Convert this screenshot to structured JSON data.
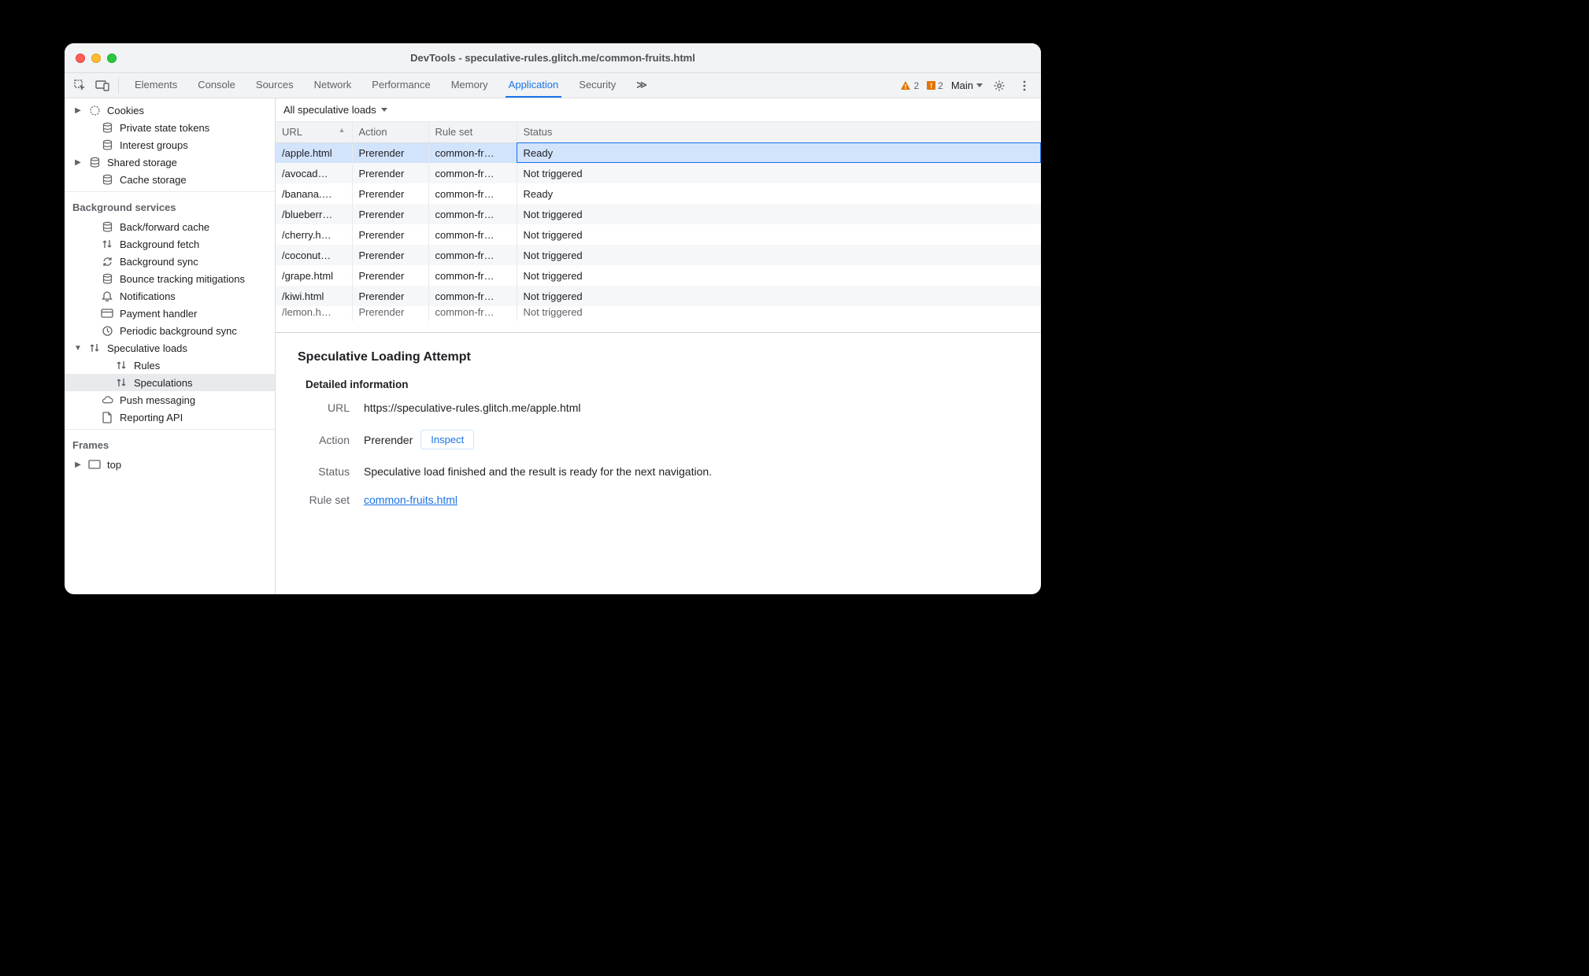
{
  "window_title": "DevTools - speculative-rules.glitch.me/common-fruits.html",
  "toolbar": {
    "tabs": [
      "Elements",
      "Console",
      "Sources",
      "Network",
      "Performance",
      "Memory",
      "Application",
      "Security"
    ],
    "active_tab": "Application",
    "overflow_glyph": "≫",
    "warnings_count": "2",
    "issues_count": "2",
    "target_label": "Main",
    "issue_sq_glyph": "!"
  },
  "sidebar": {
    "group_app": [
      {
        "label": "Cookies",
        "icon": "cookies",
        "arrow": "▶",
        "indent": 0
      },
      {
        "label": "Private state tokens",
        "icon": "db",
        "arrow": "",
        "indent": 1
      },
      {
        "label": "Interest groups",
        "icon": "db",
        "arrow": "",
        "indent": 1
      },
      {
        "label": "Shared storage",
        "icon": "db",
        "arrow": "▶",
        "indent": 0
      },
      {
        "label": "Cache storage",
        "icon": "db",
        "arrow": "",
        "indent": 1
      }
    ],
    "bg_header": "Background services",
    "group_bg": [
      {
        "label": "Back/forward cache",
        "icon": "db",
        "arrow": "",
        "indent": 1
      },
      {
        "label": "Background fetch",
        "icon": "updown",
        "arrow": "",
        "indent": 1
      },
      {
        "label": "Background sync",
        "icon": "sync",
        "arrow": "",
        "indent": 1
      },
      {
        "label": "Bounce tracking mitigations",
        "icon": "db",
        "arrow": "",
        "indent": 1
      },
      {
        "label": "Notifications",
        "icon": "bell",
        "arrow": "",
        "indent": 1
      },
      {
        "label": "Payment handler",
        "icon": "card",
        "arrow": "",
        "indent": 1
      },
      {
        "label": "Periodic background sync",
        "icon": "clock",
        "arrow": "",
        "indent": 1
      },
      {
        "label": "Speculative loads",
        "icon": "updown",
        "arrow": "▼",
        "indent": 0
      },
      {
        "label": "Rules",
        "icon": "updown",
        "arrow": "",
        "indent": 2
      },
      {
        "label": "Speculations",
        "icon": "updown",
        "arrow": "",
        "indent": 2,
        "selected": true
      },
      {
        "label": "Push messaging",
        "icon": "cloud",
        "arrow": "",
        "indent": 1
      },
      {
        "label": "Reporting API",
        "icon": "file",
        "arrow": "",
        "indent": 1
      }
    ],
    "frames_header": "Frames",
    "frames": [
      {
        "label": "top",
        "icon": "frame",
        "arrow": "▶",
        "indent": 0
      }
    ]
  },
  "filter_label": "All speculative loads",
  "table": {
    "columns": [
      "URL",
      "Action",
      "Rule set",
      "Status"
    ],
    "widths": [
      "95",
      "95",
      "110",
      "auto"
    ],
    "sort_col": 0,
    "rows": [
      {
        "url": "/apple.html",
        "action": "Prerender",
        "ruleset": "common-fr…",
        "status": "Ready",
        "selected": true
      },
      {
        "url": "/avocad…",
        "action": "Prerender",
        "ruleset": "common-fr…",
        "status": "Not triggered"
      },
      {
        "url": "/banana.…",
        "action": "Prerender",
        "ruleset": "common-fr…",
        "status": "Ready"
      },
      {
        "url": "/blueberr…",
        "action": "Prerender",
        "ruleset": "common-fr…",
        "status": "Not triggered"
      },
      {
        "url": "/cherry.h…",
        "action": "Prerender",
        "ruleset": "common-fr…",
        "status": "Not triggered"
      },
      {
        "url": "/coconut…",
        "action": "Prerender",
        "ruleset": "common-fr…",
        "status": "Not triggered"
      },
      {
        "url": "/grape.html",
        "action": "Prerender",
        "ruleset": "common-fr…",
        "status": "Not triggered"
      },
      {
        "url": "/kiwi.html",
        "action": "Prerender",
        "ruleset": "common-fr…",
        "status": "Not triggered"
      },
      {
        "url": "/lemon.h…",
        "action": "Prerender",
        "ruleset": "common-fr…",
        "status": "Not triggered",
        "cutoff": true
      }
    ]
  },
  "details": {
    "heading": "Speculative Loading Attempt",
    "sub_heading": "Detailed information",
    "labels": {
      "url": "URL",
      "action": "Action",
      "status": "Status",
      "ruleset": "Rule set"
    },
    "url": "https://speculative-rules.glitch.me/apple.html",
    "action": "Prerender",
    "inspect_label": "Inspect",
    "status": "Speculative load finished and the result is ready for the next navigation.",
    "ruleset_link": "common-fruits.html"
  }
}
